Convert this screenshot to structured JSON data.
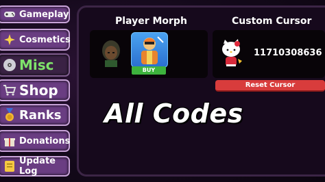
{
  "sidebar": {
    "items": [
      {
        "label": "Gameplay",
        "icon": "controller-icon",
        "active": false
      },
      {
        "label": "Cosmetics",
        "icon": "sparkle-icon",
        "active": false
      },
      {
        "label": "Misc",
        "icon": "disc-icon",
        "active": true
      },
      {
        "label": "Shop",
        "icon": "cart-icon",
        "active": false
      },
      {
        "label": "Ranks",
        "icon": "medal-icon",
        "active": false
      },
      {
        "label": "Donations",
        "icon": "gift-icon",
        "active": false
      },
      {
        "label": "Update Log",
        "icon": "note-icon",
        "active": false
      }
    ]
  },
  "player_morph": {
    "title": "Player Morph",
    "buy_label": "BUY"
  },
  "custom_cursor": {
    "title": "Custom Cursor",
    "cursor_id": "11710308636",
    "reset_label": "Reset Cursor"
  },
  "overlay": {
    "title": "All Codes"
  },
  "colors": {
    "nav_bg": "#6a3d82",
    "nav_border": "#c9a3d9",
    "active_text": "#7fe36b",
    "buy_green": "#3db33d",
    "reset_red": "#d83c3c"
  }
}
